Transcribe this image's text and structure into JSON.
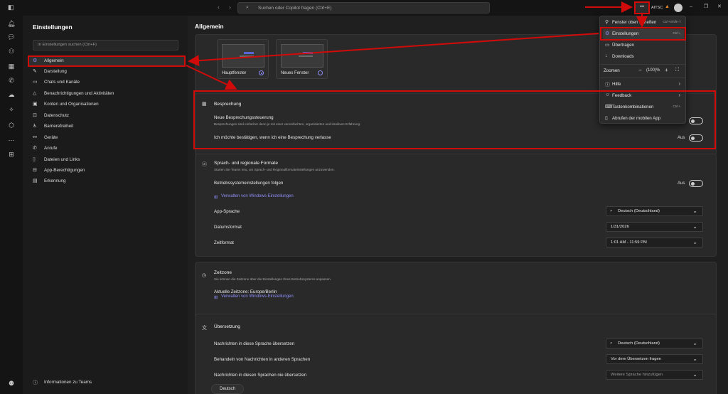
{
  "titlebar": {
    "search_placeholder": "Suchen oder Copilot fragen (Ctrl+E)",
    "more_label": "•••",
    "org": "AITSC"
  },
  "sidebar": {
    "title": "Einstellungen",
    "search_placeholder": "In Einstellungen suchen (Ctrl+F)",
    "items": [
      {
        "label": "Allgemein",
        "icon": "gear-icon"
      },
      {
        "label": "Darstellung",
        "icon": "brush-icon"
      },
      {
        "label": "Chats und Kanäle",
        "icon": "chat-icon"
      },
      {
        "label": "Benachrichtigungen und Aktivitäten",
        "icon": "bell-icon"
      },
      {
        "label": "Konten und Organisationen",
        "icon": "accounts-icon"
      },
      {
        "label": "Datenschutz",
        "icon": "lock-icon"
      },
      {
        "label": "Barrierefreiheit",
        "icon": "accessibility-icon"
      },
      {
        "label": "Geräte",
        "icon": "devices-icon"
      },
      {
        "label": "Anrufe",
        "icon": "phone-icon"
      },
      {
        "label": "Dateien und Links",
        "icon": "file-icon"
      },
      {
        "label": "App-Berechtigungen",
        "icon": "apps-icon"
      },
      {
        "label": "Erkennung",
        "icon": "recognition-icon"
      }
    ],
    "about": "Informationen zu Teams"
  },
  "main": {
    "title": "Allgemein",
    "window_options": [
      {
        "label": "Hauptfenster",
        "selected": true
      },
      {
        "label": "Neues Fenster",
        "selected": false
      }
    ],
    "meeting": {
      "title": "Besprechung",
      "new_controls_label": "Neue Besprechungssteuerung",
      "new_controls_sub": "Besprechungen sind einfacher denn je mit einer vereinfachten, organisierten und intuitiven Erfahrung.",
      "confirm_leave_label": "Ich möchte bestätigen, wenn ich eine Besprechung verlasse",
      "confirm_leave_state": "Aus"
    },
    "language": {
      "title": "Sprach- und regionale Formate",
      "sub": "Starten Sie Teams neu, um Sprach- und Regionalformateinstellungen anzuwenden.",
      "os_follow_label": "Betriebssystemeinstellungen folgen",
      "os_follow_state": "Aus",
      "manage_link": "Verwalten von Windows-Einstellungen",
      "app_language_label": "App-Sprache",
      "app_language_value": "Deutsch (Deutschland)",
      "date_label": "Datumsformat",
      "date_value": "1/31/2026",
      "time_label": "Zeitformat",
      "time_value": "1:01 AM - 11:59 PM"
    },
    "timezone": {
      "title": "Zeitzone",
      "sub": "Sie können die Zeitzone über die Einstellungen Ihres Betriebssystems anpassen.",
      "current": "Aktuelle Zeitzone: Europe/Berlin",
      "manage_link": "Verwalten von Windows-Einstellungen"
    },
    "translation": {
      "title": "Übersetzung",
      "translate_to_label": "Nachrichten in diese Sprache übersetzen",
      "translate_to_value": "Deutsch (Deutschland)",
      "other_lang_label": "Behandeln von Nachrichten in anderen Sprachen",
      "other_lang_value": "Vor dem Übersetzen fragen",
      "never_label": "Nachrichten in diesen Sprachen nie übersetzen",
      "never_placeholder": "Weitere Sprache hinzufügen",
      "chip": "Deutsch"
    }
  },
  "menu": {
    "items": [
      {
        "label": "Fenster oben anheften",
        "shortcut": "Ctrl+Shift+T",
        "icon": "pin-icon"
      },
      {
        "label": "Einstellungen",
        "shortcut": "Ctrl+,",
        "icon": "gear-icon"
      },
      {
        "label": "Übertragen",
        "icon": "cast-icon"
      },
      {
        "label": "Downloads",
        "icon": "download-icon"
      }
    ],
    "zoom_label": "Zoomen",
    "zoom_value": "(100)%",
    "help": "Hilfe",
    "feedback": "Feedback",
    "shortcuts_label": "Tastenkombinationen",
    "shortcuts_sc": "Ctrl+.",
    "mobile": "Abrufen der mobilen App"
  },
  "colors": {
    "accent": "#8d8cf5",
    "annotation": "#d10a0a"
  }
}
